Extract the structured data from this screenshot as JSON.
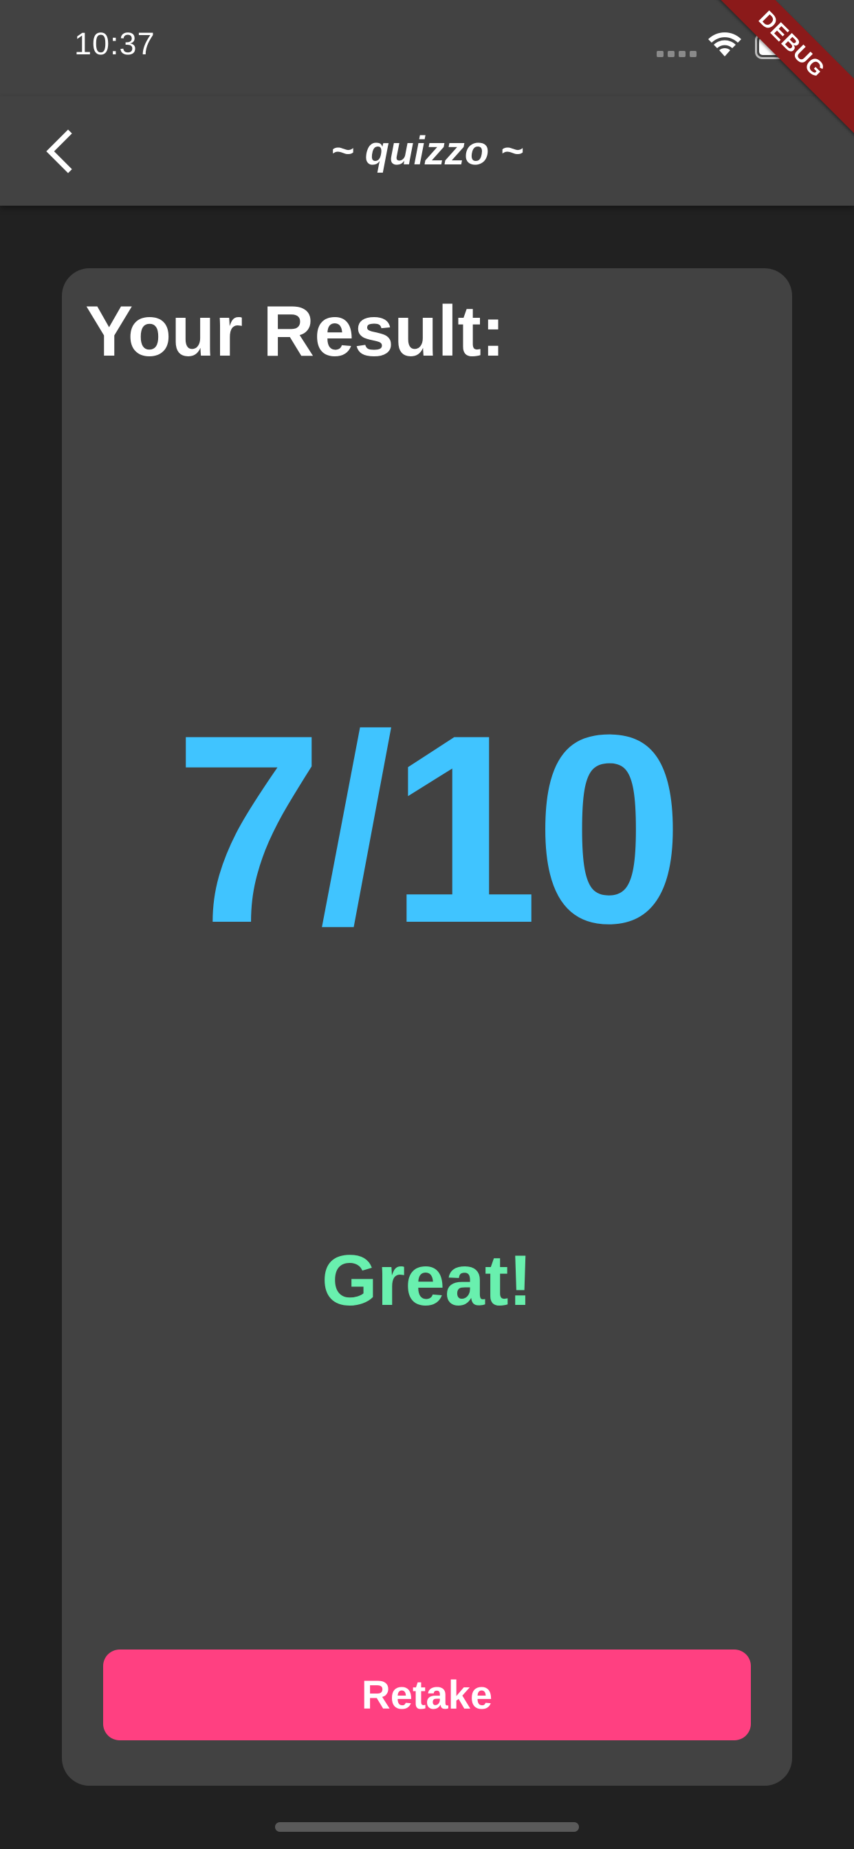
{
  "status_bar": {
    "time": "10:37",
    "icons": [
      "signal-icon",
      "wifi-icon",
      "battery-icon"
    ]
  },
  "app_bar": {
    "title": "~ quizzo ~",
    "back_icon": "chevron-left-icon"
  },
  "debug_banner": {
    "label": "DEBUG"
  },
  "result": {
    "heading": "Your Result:",
    "score_value": 7,
    "score_total": 10,
    "score_text": "7/10",
    "feedback": "Great!",
    "retake_label": "Retake"
  },
  "colors": {
    "background": "#212121",
    "surface": "#424242",
    "score": "#40c4ff",
    "feedback": "#69f0ae",
    "button": "#ff4081",
    "debug_banner": "#8b1a1a"
  }
}
